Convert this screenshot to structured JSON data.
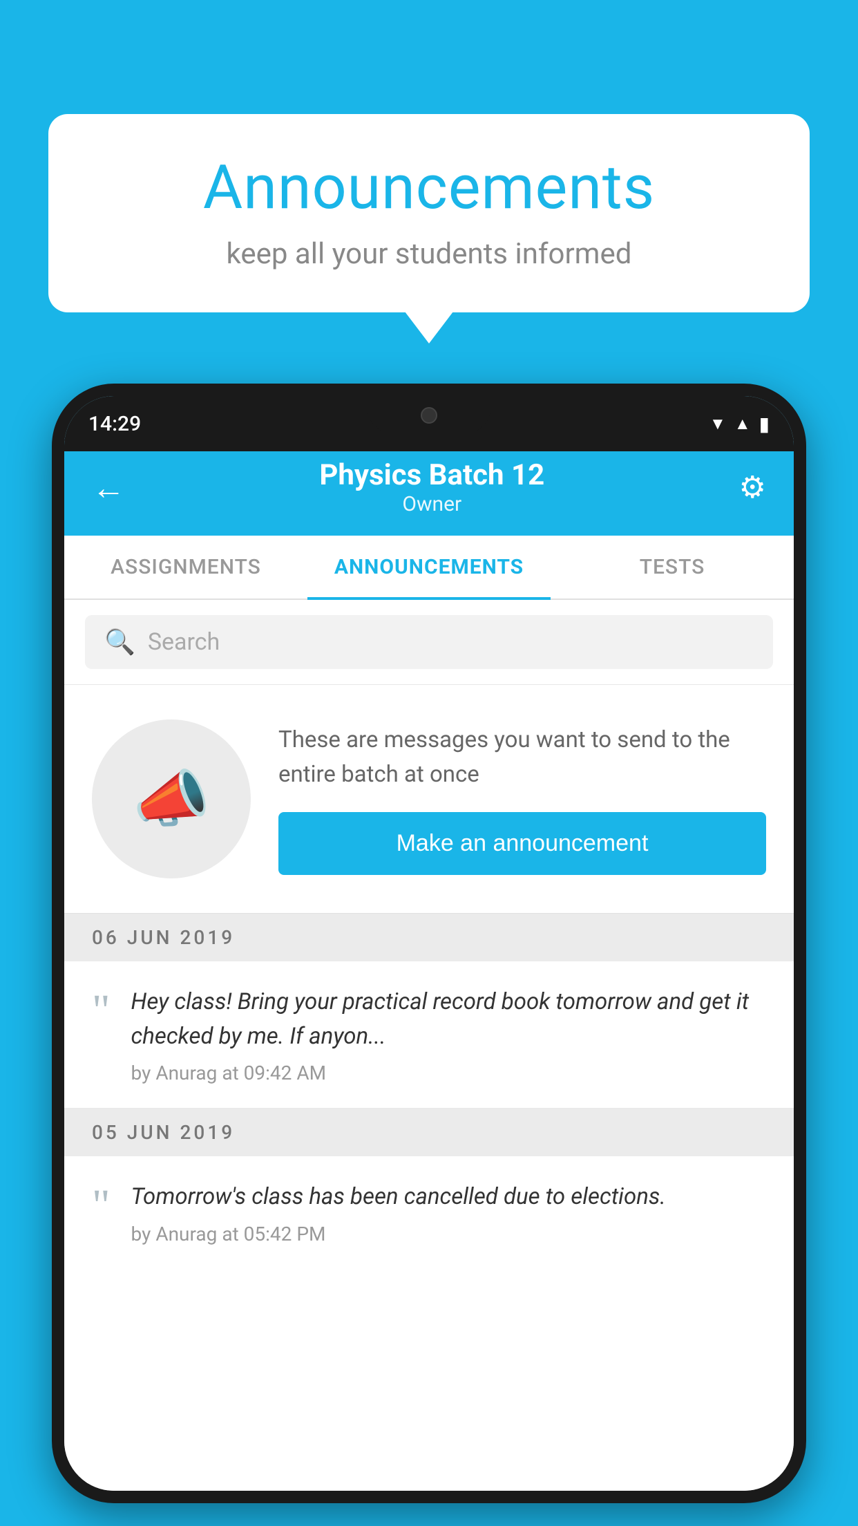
{
  "background_color": "#1ab5e8",
  "speech_bubble": {
    "title": "Announcements",
    "subtitle": "keep all your students informed"
  },
  "status_bar": {
    "time": "14:29",
    "wifi_icon": "wifi",
    "signal_icon": "signal",
    "battery_icon": "battery"
  },
  "app_bar": {
    "back_icon": "←",
    "title": "Physics Batch 12",
    "subtitle": "Owner",
    "settings_icon": "⚙"
  },
  "tabs": [
    {
      "label": "ASSIGNMENTS",
      "active": false
    },
    {
      "label": "ANNOUNCEMENTS",
      "active": true
    },
    {
      "label": "TESTS",
      "active": false
    }
  ],
  "search": {
    "placeholder": "Search"
  },
  "announcement_prompt": {
    "description_text": "These are messages you want to send to the entire batch at once",
    "button_label": "Make an announcement"
  },
  "date_groups": [
    {
      "date_label": "06  JUN  2019",
      "items": [
        {
          "message": "Hey class! Bring your practical record book tomorrow and get it checked by me. If anyon...",
          "by": "by Anurag at 09:42 AM"
        }
      ]
    },
    {
      "date_label": "05  JUN  2019",
      "items": [
        {
          "message": "Tomorrow's class has been cancelled due to elections.",
          "by": "by Anurag at 05:42 PM"
        }
      ]
    }
  ]
}
